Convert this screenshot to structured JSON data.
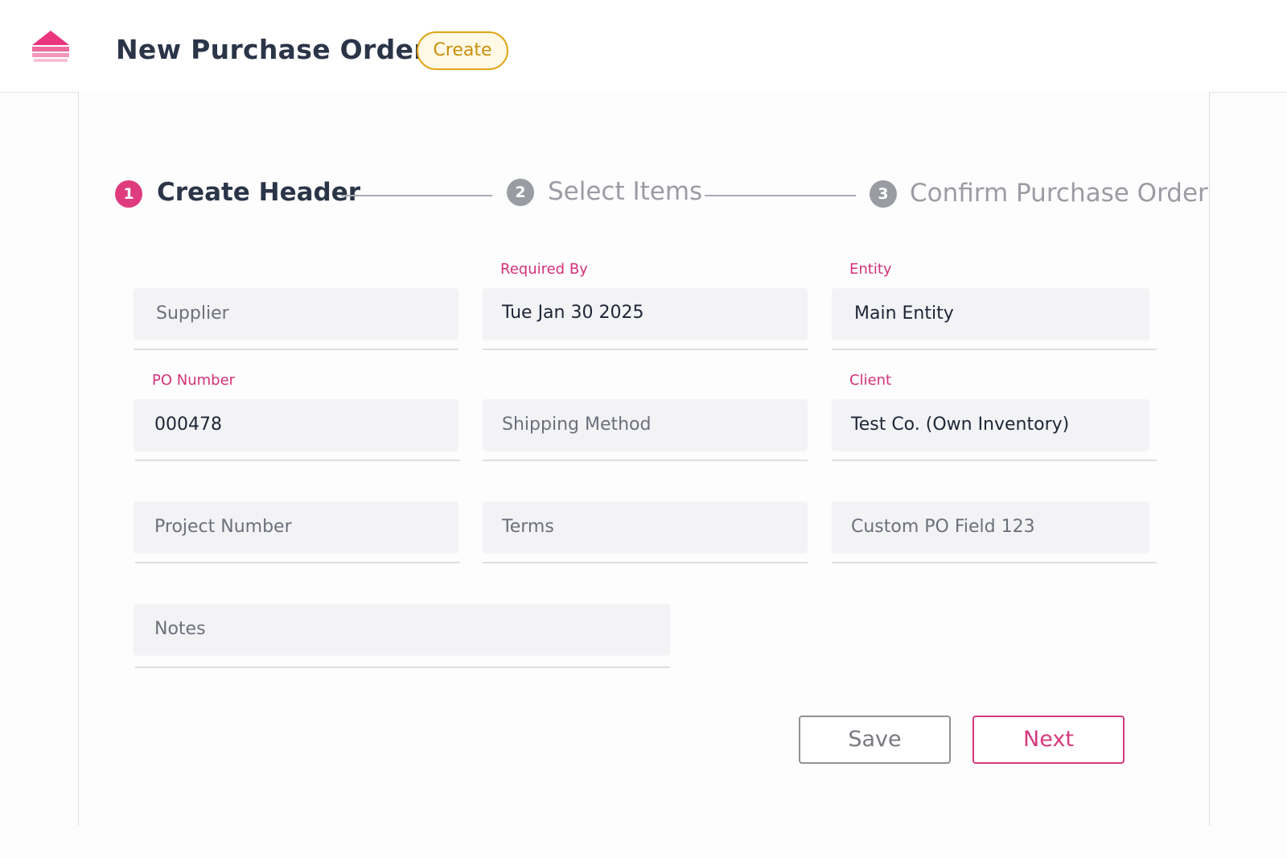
{
  "header": {
    "title": "New Purchase Order",
    "status_badge": "Create"
  },
  "stepper": {
    "steps": [
      {
        "number": "1",
        "label": "Create Header",
        "state": "active"
      },
      {
        "number": "2",
        "label": "Select Items",
        "state": "inactive"
      },
      {
        "number": "3",
        "label": "Confirm Purchase Order",
        "state": "inactive"
      }
    ]
  },
  "form": {
    "supplier": {
      "label": "",
      "value": "",
      "placeholder": "Supplier"
    },
    "required_by": {
      "label": "Required By",
      "value": "Tue Jan 30 2025",
      "placeholder": ""
    },
    "entity": {
      "label": "Entity",
      "value": "Main Entity",
      "placeholder": ""
    },
    "po_number": {
      "label": "PO Number",
      "value": "000478",
      "placeholder": ""
    },
    "shipping_method": {
      "label": "",
      "value": "",
      "placeholder": "Shipping Method"
    },
    "client": {
      "label": "Client",
      "value": "Test Co. (Own Inventory)",
      "placeholder": ""
    },
    "project_number": {
      "label": "",
      "value": "",
      "placeholder": "Project Number"
    },
    "terms": {
      "label": "",
      "value": "",
      "placeholder": "Terms"
    },
    "custom_po_field": {
      "label": "",
      "value": "",
      "placeholder": "Custom PO Field 123"
    },
    "notes": {
      "label": "",
      "value": "",
      "placeholder": "Notes"
    }
  },
  "actions": {
    "save_label": "Save",
    "next_label": "Next"
  },
  "colors": {
    "accent": "#d63a7e",
    "badge": "#e0a618",
    "inactive_step": "#9a9ca3"
  },
  "icons": {
    "logo": "stacked-chevron-logo"
  }
}
